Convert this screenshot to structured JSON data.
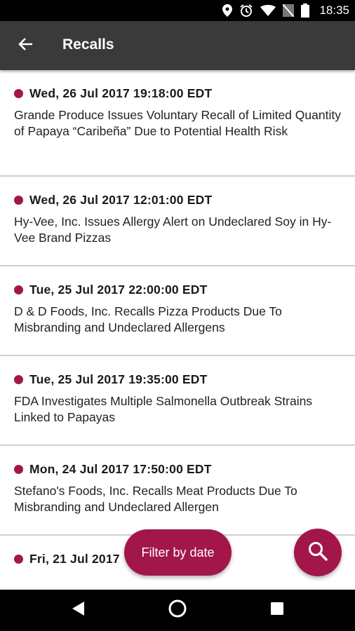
{
  "status_bar": {
    "time": "18:35",
    "icons": [
      "location-icon",
      "alarm-icon",
      "wifi-icon",
      "no-sim-icon",
      "battery-icon"
    ]
  },
  "app_bar": {
    "title": "Recalls",
    "back_icon": "arrow-back-icon"
  },
  "recalls": [
    {
      "date": "Wed, 26 Jul 2017 19:18:00 EDT",
      "title": "Grande Produce Issues Voluntary Recall of Limited Quantity of Papaya “Caribeña” Due to Potential Health Risk"
    },
    {
      "date": "Wed, 26 Jul 2017 12:01:00 EDT",
      "title": "Hy-Vee, Inc. Issues Allergy Alert on Undeclared Soy in Hy-Vee Brand Pizzas"
    },
    {
      "date": "Tue, 25 Jul 2017 22:00:00 EDT",
      "title": "D & D Foods, Inc. Recalls Pizza Products Due To Misbranding and Undeclared Allergens"
    },
    {
      "date": "Tue, 25 Jul 2017 19:35:00 EDT",
      "title": "FDA Investigates Multiple Salmonella Outbreak Strains Linked to Papayas"
    },
    {
      "date": "Mon, 24 Jul 2017 17:50:00 EDT",
      "title": "Stefano's Foods, Inc. Recalls Meat Products Due To Misbranding and Undeclared Allergen"
    },
    {
      "date": "Fri, 21 Jul 2017",
      "title": ""
    }
  ],
  "filter_button": {
    "label": "Filter by date"
  },
  "search_button": {
    "icon": "search-icon"
  },
  "colors": {
    "accent": "#a3164a",
    "app_bar": "#3a3a3a",
    "divider": "#cfcfcf"
  },
  "nav_bar": {
    "icons": [
      "back-triangle-icon",
      "home-circle-icon",
      "recents-square-icon"
    ]
  }
}
